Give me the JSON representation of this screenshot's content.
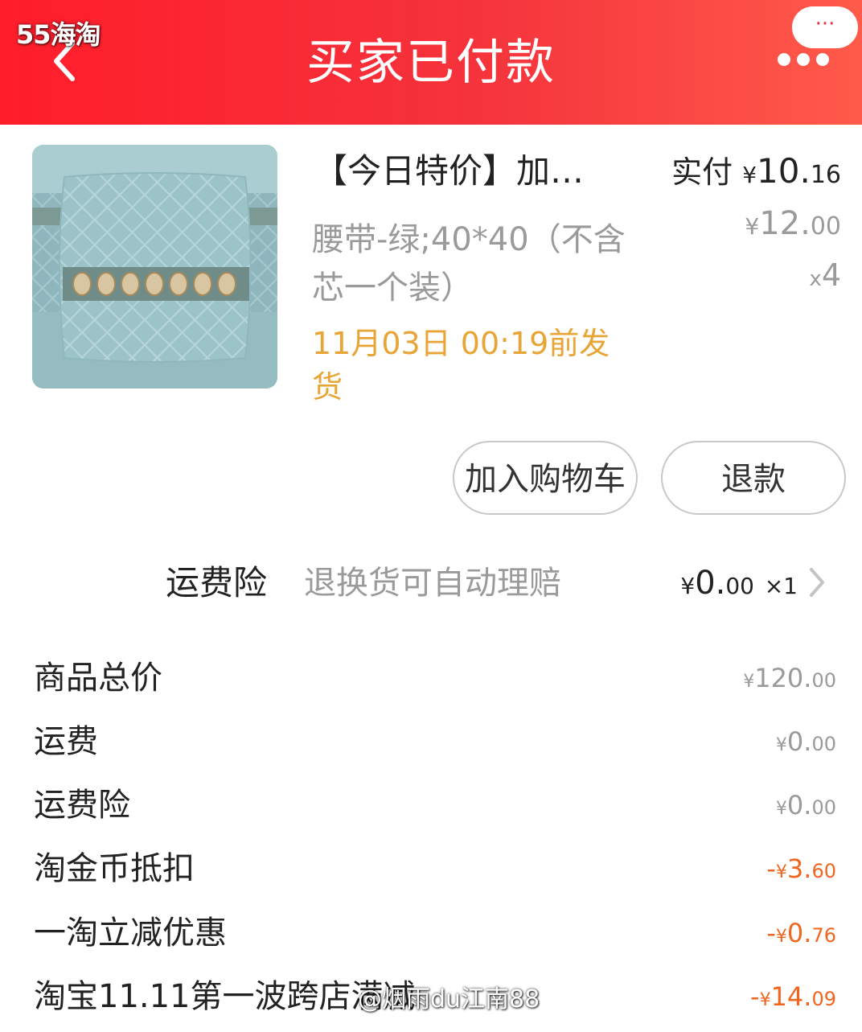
{
  "watermark_top": "55海淘",
  "header": {
    "title": "买家已付款",
    "more_label": "···"
  },
  "product": {
    "title": "【今日特价】加…",
    "paid_label": "实付",
    "paid_yen": "¥",
    "paid_int": "10.",
    "paid_dec": "16",
    "orig_yen": "¥",
    "orig_int": "12.",
    "orig_dec": "00",
    "qty_x": "x",
    "qty_n": "4",
    "sku": "腰带-绿;40*40（不含芯一个装）",
    "ship_deadline": "11月03日 00:19前发货"
  },
  "buttons": {
    "add_to_cart": "加入购物车",
    "refund": "退款"
  },
  "insurance": {
    "label": "运费险",
    "desc": "退换货可自动理赔",
    "yen": "¥",
    "int": "0.",
    "dec": "00",
    "qty": "×1"
  },
  "summary": [
    {
      "label": "商品总价",
      "sign": "",
      "yen": "¥",
      "int": "120.",
      "dec": "00"
    },
    {
      "label": "运费",
      "sign": "",
      "yen": "¥",
      "int": "0.",
      "dec": "00"
    },
    {
      "label": "运费险",
      "sign": "",
      "yen": "¥",
      "int": "0.",
      "dec": "00"
    },
    {
      "label": "淘金币抵扣",
      "sign": "-",
      "yen": "¥",
      "int": "3.",
      "dec": "60"
    },
    {
      "label": "一淘立减优惠",
      "sign": "-",
      "yen": "¥",
      "int": "0.",
      "dec": "76"
    },
    {
      "label": "淘宝11.11第一波跨店满减",
      "sign": "-",
      "yen": "¥",
      "int": "14.",
      "dec": "09"
    }
  ],
  "watermark_bottom": "@烟雨du江南88",
  "colors": {
    "header": "#f5333c",
    "deadline": "#e8a434",
    "discount": "#f0661e"
  }
}
